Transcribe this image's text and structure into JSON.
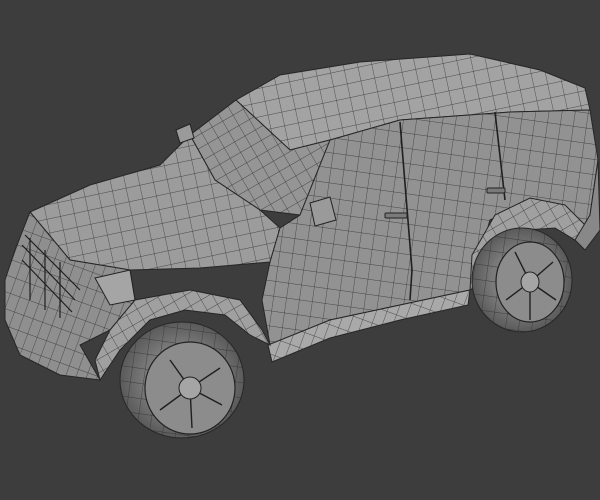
{
  "viewport": {
    "background": "#3d3d3d",
    "shading": "solid-grey-with-wireframe"
  },
  "model": {
    "object": "suv-car-mesh",
    "body_color": "#9a9a9a",
    "wire_color": "#2a2a2a",
    "tire_color": "#6e6e6e",
    "rim_color": "#a8a8a8"
  }
}
